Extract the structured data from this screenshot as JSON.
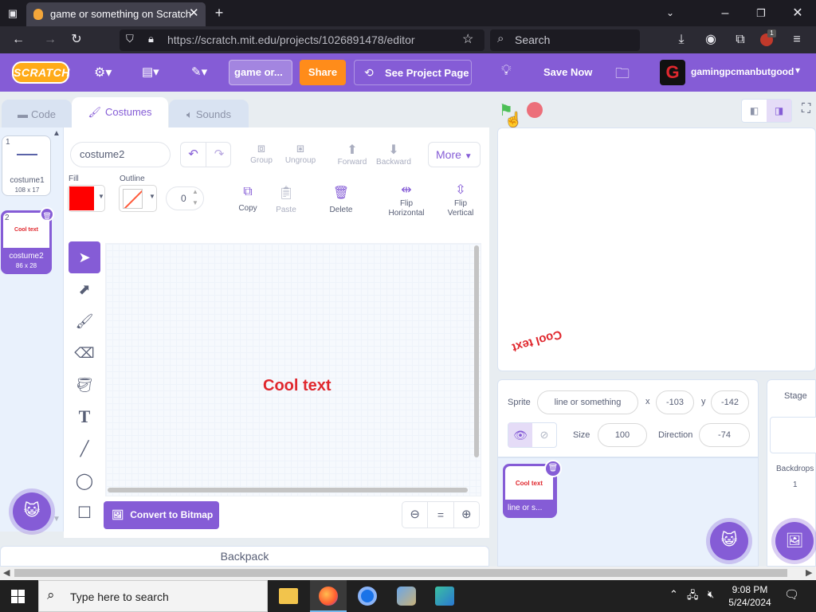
{
  "browser": {
    "tab_title": "game or something on Scratch",
    "url": "https://scratch.mit.edu/projects/1026891478/editor",
    "search_placeholder": "Search",
    "ext_badge": "1"
  },
  "menubar": {
    "logo": "SCRATCH",
    "project_title": "game or...",
    "share": "Share",
    "see_project_page": "See Project Page",
    "save_now": "Save Now",
    "username": "gamingpcmanbutgood"
  },
  "tabs": {
    "code": "Code",
    "costumes": "Costumes",
    "sounds": "Sounds"
  },
  "costumes": [
    {
      "num": "1",
      "name": "costume1",
      "size": "108 x 17"
    },
    {
      "num": "2",
      "name": "costume2",
      "size": "86 x 28",
      "preview_text": "Cool text"
    }
  ],
  "editor": {
    "costume_name": "costume2",
    "more": "More",
    "group": "Group",
    "ungroup": "Ungroup",
    "forward": "Forward",
    "backward": "Backward",
    "fill_label": "Fill",
    "outline_label": "Outline",
    "outline_width": "0",
    "copy": "Copy",
    "paste": "Paste",
    "delete": "Delete",
    "flip_h": "Flip\nHorizontal",
    "flip_v": "Flip\nVertical",
    "canvas_text": "Cool text",
    "convert": "Convert to Bitmap",
    "zoom_reset": "="
  },
  "backpack": "Backpack",
  "stage": {
    "text": "Cool text"
  },
  "sprite_info": {
    "sprite_label": "Sprite",
    "sprite_name": "line or something",
    "x_label": "x",
    "x": "-103",
    "y_label": "y",
    "y": "-142",
    "size_label": "Size",
    "size": "100",
    "direction_label": "Direction",
    "direction": "-74"
  },
  "sprite_tile": {
    "name": "line or s...",
    "preview_text": "Cool text"
  },
  "stage_panel": {
    "title": "Stage",
    "backdrops_label": "Backdrops",
    "backdrops_count": "1"
  },
  "taskbar": {
    "search": "Type here to search",
    "time": "9:08 PM",
    "date": "5/24/2024"
  },
  "colors": {
    "scratch_purple": "#855cd6",
    "fill_red": "#ff0000",
    "share_orange": "#ff8c1a",
    "text_red": "#e0282e"
  }
}
